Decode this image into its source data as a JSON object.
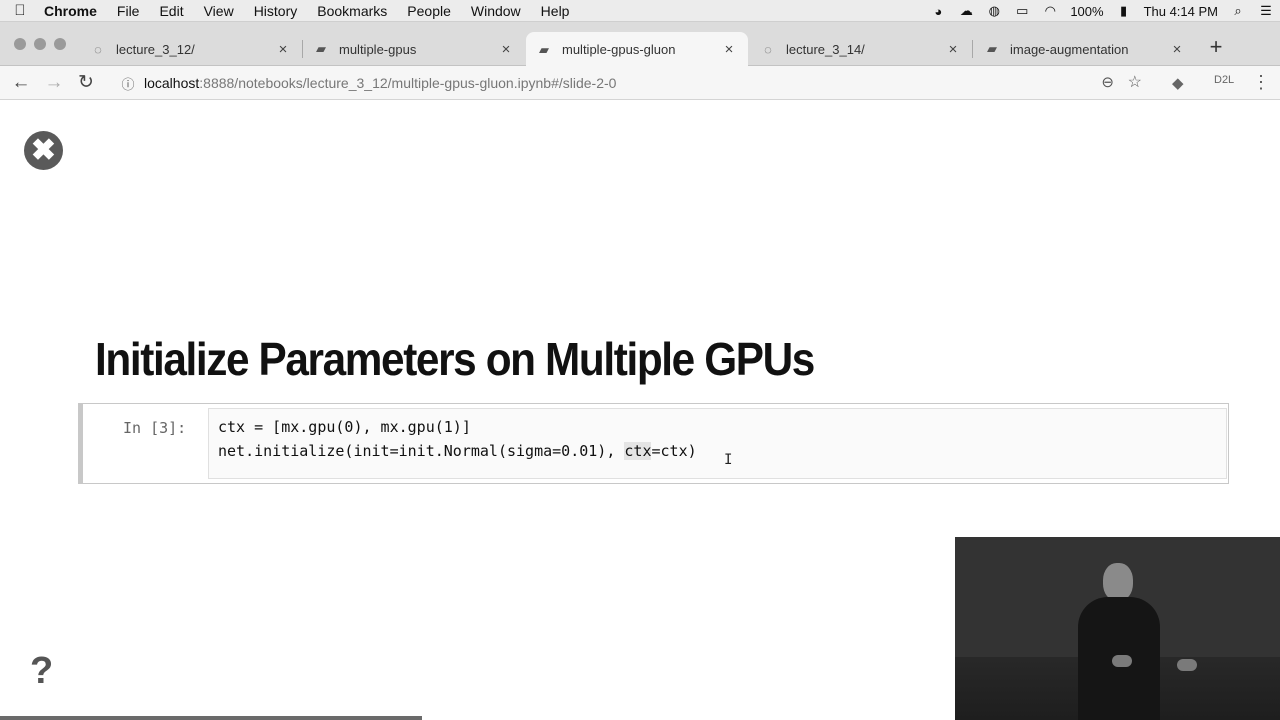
{
  "menubar": {
    "apple_icon": "apple-icon",
    "items": [
      "Chrome",
      "File",
      "Edit",
      "View",
      "History",
      "Bookmarks",
      "People",
      "Window",
      "Help"
    ],
    "battery": "100%",
    "clock": "Thu 4:14 PM",
    "status_icons": [
      "creative-cloud-icon",
      "cloud-icon",
      "globe-icon",
      "airplay-icon",
      "wifi-icon",
      "battery-icon",
      "search-icon"
    ]
  },
  "tabs": [
    {
      "label": "lecture_3_12/",
      "icon": "loading-icon",
      "close": "×"
    },
    {
      "label": "multiple-gpus",
      "icon": "page-icon",
      "close": "×"
    },
    {
      "label": "multiple-gpus-gluon",
      "icon": "page-icon",
      "close": "×",
      "active": true
    },
    {
      "label": "lecture_3_14/",
      "icon": "loading-icon",
      "close": "×"
    },
    {
      "label": "image-augmentation",
      "icon": "page-icon",
      "close": "×"
    }
  ],
  "new_tab_label": "+",
  "toolbar": {
    "url_host": "localhost",
    "url_path": ":8888/notebooks/lecture_3_12/multiple-gpus-gluon.ipynb#/slide-2-0",
    "extension_label": "D2L"
  },
  "slide": {
    "close_label": "✖",
    "title": "Initialize Parameters on Multiple GPUs",
    "prompt": "In [3]:",
    "code_line_1": "ctx = [mx.gpu(0), mx.gpu(1)]",
    "code_line_2_pre": "net.initialize(init=init.Normal(sigma=0.01), ",
    "code_line_2_hl": "ctx",
    "code_line_2_post": "=ctx)",
    "help_label": "?"
  },
  "progress": 0.33
}
